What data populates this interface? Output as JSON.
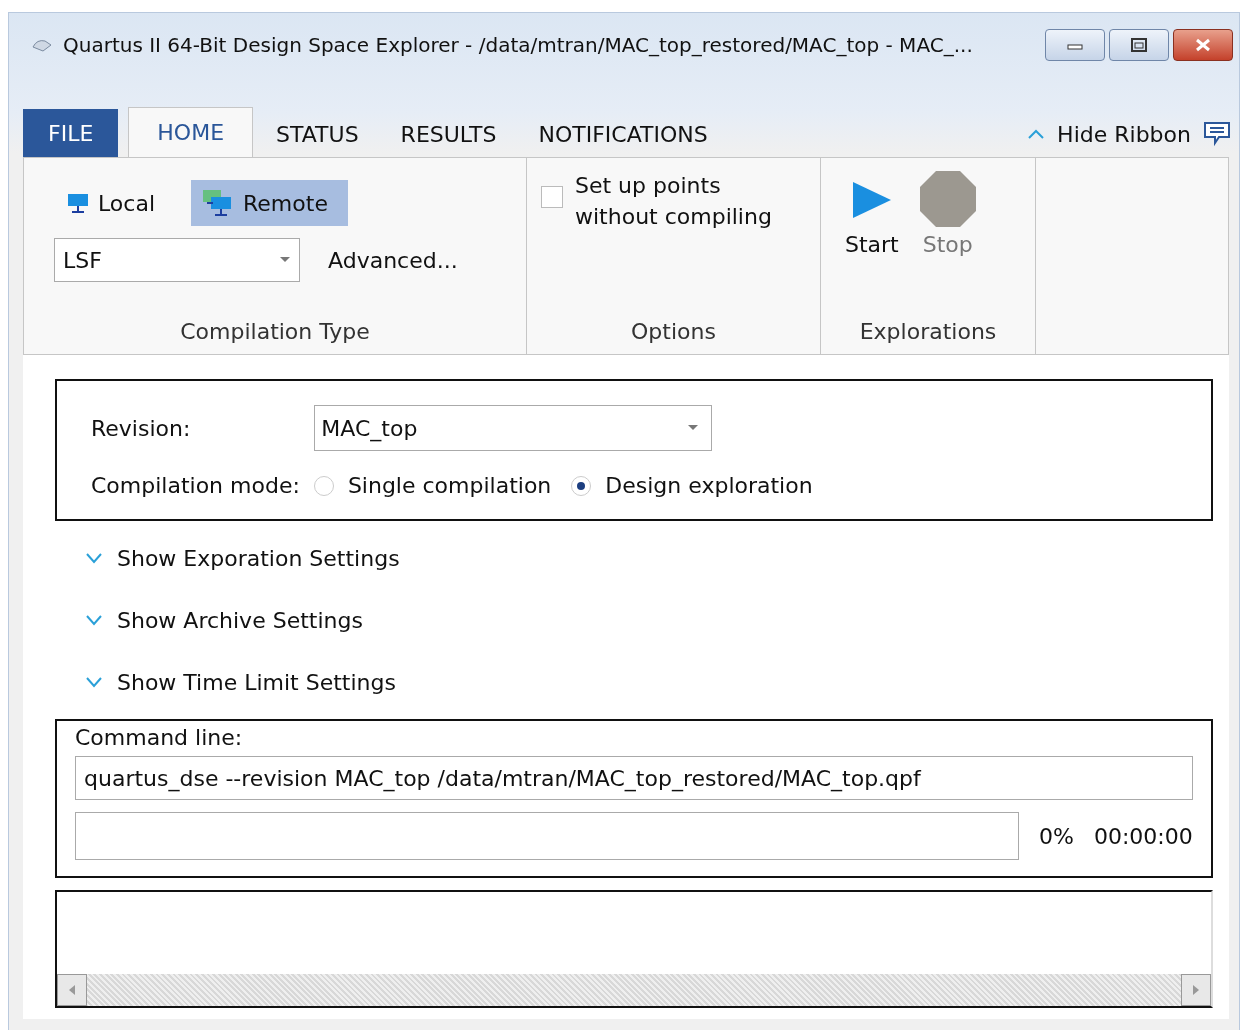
{
  "window": {
    "title": "Quartus II 64-Bit Design Space Explorer - /data/mtran/MAC_top_restored/MAC_top - MAC_..."
  },
  "tabs": [
    {
      "label": "FILE",
      "kind": "file",
      "selected": false
    },
    {
      "label": "HOME",
      "kind": "tab",
      "selected": true
    },
    {
      "label": "STATUS",
      "kind": "tab",
      "selected": false
    },
    {
      "label": "RESULTS",
      "kind": "tab",
      "selected": false
    },
    {
      "label": "NOTIFICATIONS",
      "kind": "tab",
      "selected": false
    }
  ],
  "hide_ribbon": {
    "label": "Hide Ribbon"
  },
  "ribbon": {
    "compilation_type": {
      "title": "Compilation Type",
      "modes": [
        {
          "label": "Local",
          "selected": false
        },
        {
          "label": "Remote",
          "selected": true
        }
      ],
      "scheduler": "LSF",
      "advanced": "Advanced..."
    },
    "options": {
      "title": "Options",
      "checkbox": {
        "label": "Set up points without compiling",
        "checked": false
      }
    },
    "explorations": {
      "title": "Explorations",
      "buttons": [
        {
          "label": "Start",
          "kind": "start",
          "disabled": false
        },
        {
          "label": "Stop",
          "kind": "stop",
          "disabled": true
        }
      ]
    }
  },
  "settings": {
    "revision_label": "Revision:",
    "revision": "MAC_top",
    "mode_label": "Compilation mode:",
    "modes": [
      {
        "label": "Single compilation",
        "selected": false
      },
      {
        "label": "Design exploration",
        "selected": true
      }
    ]
  },
  "expanders": [
    {
      "label": "Show Exporation Settings",
      "expanded": false
    },
    {
      "label": "Show Archive Settings",
      "expanded": false
    },
    {
      "label": "Show Time Limit Settings",
      "expanded": false
    }
  ],
  "command": {
    "label": "Command line:",
    "value": "quartus_dse --revision MAC_top /data/mtran/MAC_top_restored/MAC_top.qpf",
    "progress": {
      "level": 0,
      "percent": "0%",
      "elapsed": "00:00:00"
    }
  }
}
